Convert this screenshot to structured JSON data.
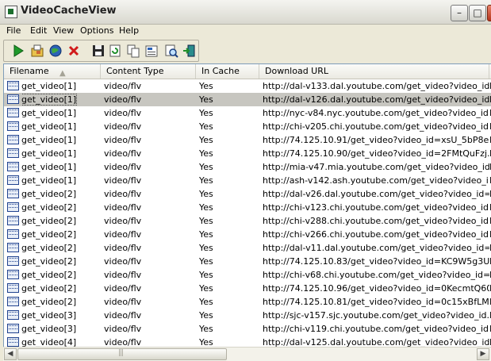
{
  "window": {
    "title": "VideoCacheView"
  },
  "title_buttons": {
    "minimize": "–",
    "maximize": "□",
    "close": "✕"
  },
  "menu": [
    "File",
    "Edit",
    "View",
    "Options",
    "Help"
  ],
  "toolbar": [
    "play-icon",
    "open-folder-icon",
    "web-globe-icon",
    "delete-x-icon",
    "save-disk-icon",
    "refresh-icon",
    "copy-icon",
    "properties-icon",
    "find-icon",
    "exit-icon"
  ],
  "columns": [
    "Filename",
    "Content Type",
    "In Cache",
    "Download URL"
  ],
  "rows": [
    {
      "filename": "get_video[1]",
      "type": "video/flv",
      "cache": "Yes",
      "url": "http://dal-v133.dal.youtube.com/get_video?video_id...",
      "extra": "I"
    },
    {
      "filename": "get_video[1]",
      "type": "video/flv",
      "cache": "Yes",
      "url": "http://dal-v126.dal.youtube.com/get_video?video_id...",
      "extra": "I"
    },
    {
      "filename": "get_video[1]",
      "type": "video/flv",
      "cache": "Yes",
      "url": "http://nyc-v84.nyc.youtube.com/get_video?video_id...",
      "extra": "I"
    },
    {
      "filename": "get_video[1]",
      "type": "video/flv",
      "cache": "Yes",
      "url": "http://chi-v205.chi.youtube.com/get_video?video_id...",
      "extra": "I"
    },
    {
      "filename": "get_video[1]",
      "type": "video/flv",
      "cache": "Yes",
      "url": "http://74.125.10.91/get_video?video_id=xsU_5bP8e...",
      "extra": "I"
    },
    {
      "filename": "get_video[1]",
      "type": "video/flv",
      "cache": "Yes",
      "url": "http://74.125.10.90/get_video?video_id=2FMtQuFzj...",
      "extra": "I"
    },
    {
      "filename": "get_video[1]",
      "type": "video/flv",
      "cache": "Yes",
      "url": "http://mia-v47.mia.youtube.com/get_video?video_id...",
      "extra": "I"
    },
    {
      "filename": "get_video[1]",
      "type": "video/flv",
      "cache": "Yes",
      "url": "http://ash-v142.ash.youtube.com/get_video?video_i...",
      "extra": "I"
    },
    {
      "filename": "get_video[2]",
      "type": "video/flv",
      "cache": "Yes",
      "url": "http://dal-v26.dal.youtube.com/get_video?video_id=...",
      "extra": "I"
    },
    {
      "filename": "get_video[2]",
      "type": "video/flv",
      "cache": "Yes",
      "url": "http://chi-v123.chi.youtube.com/get_video?video_id...",
      "extra": "I"
    },
    {
      "filename": "get_video[2]",
      "type": "video/flv",
      "cache": "Yes",
      "url": "http://chi-v288.chi.youtube.com/get_video?video_id...",
      "extra": "I"
    },
    {
      "filename": "get_video[2]",
      "type": "video/flv",
      "cache": "Yes",
      "url": "http://chi-v266.chi.youtube.com/get_video?video_id...",
      "extra": "I"
    },
    {
      "filename": "get_video[2]",
      "type": "video/flv",
      "cache": "Yes",
      "url": "http://dal-v11.dal.youtube.com/get_video?video_id=...",
      "extra": "I"
    },
    {
      "filename": "get_video[2]",
      "type": "video/flv",
      "cache": "Yes",
      "url": "http://74.125.10.83/get_video?video_id=KC9W5g3U...",
      "extra": "I"
    },
    {
      "filename": "get_video[2]",
      "type": "video/flv",
      "cache": "Yes",
      "url": "http://chi-v68.chi.youtube.com/get_video?video_id=...",
      "extra": "I"
    },
    {
      "filename": "get_video[2]",
      "type": "video/flv",
      "cache": "Yes",
      "url": "http://74.125.10.96/get_video?video_id=0KecmtQ60...",
      "extra": "I"
    },
    {
      "filename": "get_video[2]",
      "type": "video/flv",
      "cache": "Yes",
      "url": "http://74.125.10.81/get_video?video_id=0c15xBfLMr...",
      "extra": "I"
    },
    {
      "filename": "get_video[3]",
      "type": "video/flv",
      "cache": "Yes",
      "url": "http://sjc-v157.sjc.youtube.com/get_video?video_id...",
      "extra": "I"
    },
    {
      "filename": "get_video[3]",
      "type": "video/flv",
      "cache": "Yes",
      "url": "http://chi-v119.chi.youtube.com/get_video?video_id...",
      "extra": "I"
    },
    {
      "filename": "get_video[4]",
      "type": "video/flv",
      "cache": "Yes",
      "url": "http://dal-v125.dal.youtube.com/get_video?video_id...",
      "extra": "I"
    }
  ],
  "selected_row": 1,
  "scrollbar": {
    "left_arrow": "◀",
    "right_arrow": "▶"
  }
}
